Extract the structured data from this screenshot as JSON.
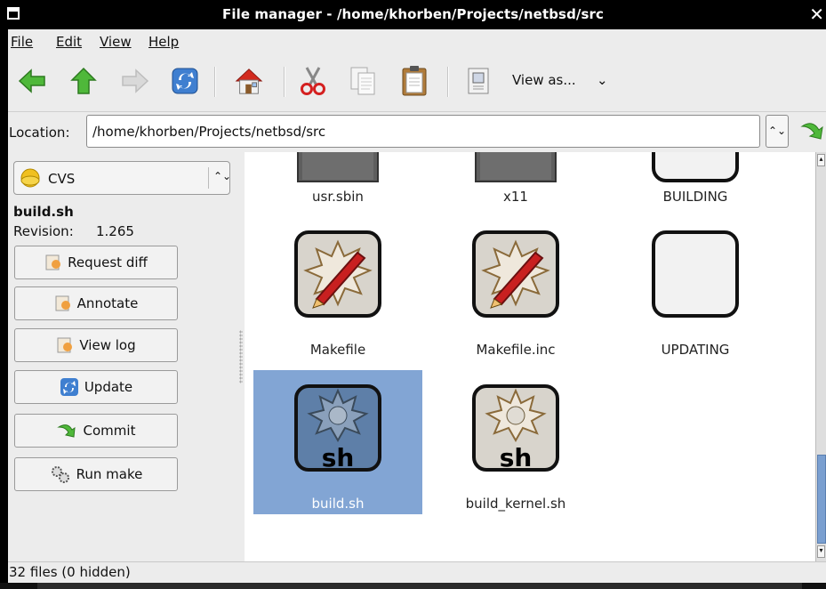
{
  "window": {
    "title": "File manager - /home/khorben/Projects/netbsd/src",
    "close_glyph": "✕"
  },
  "menu": [
    {
      "label": "File"
    },
    {
      "label": "Edit"
    },
    {
      "label": "View"
    },
    {
      "label": "Help"
    }
  ],
  "toolbar": {
    "back_icon": "back-arrow-icon",
    "up_icon": "up-arrow-icon",
    "forward_icon": "forward-arrow-icon",
    "refresh_icon": "refresh-icon",
    "home_icon": "home-icon",
    "cut_icon": "scissors-icon",
    "copy_icon": "copy-icon",
    "paste_icon": "clipboard-icon",
    "properties_icon": "properties-icon",
    "view_as_label": "View as...",
    "view_as_arrow": "⌄"
  },
  "location": {
    "label": "Location:",
    "value": "/home/khorben/Projects/netbsd/src",
    "spin": "⌃⌄"
  },
  "side": {
    "vcs_selected": "CVS",
    "vcs_spin": "⌃⌄",
    "file_name": "build.sh",
    "revision_label": "Revision:",
    "revision_value": "1.265",
    "buttons": [
      {
        "label": "Request diff",
        "icon": "document-hand-icon"
      },
      {
        "label": "Annotate",
        "icon": "document-hand-icon"
      },
      {
        "label": "View log",
        "icon": "document-hand-icon"
      },
      {
        "label": "Update",
        "icon": "refresh-icon"
      },
      {
        "label": "Commit",
        "icon": "green-arrow-icon"
      },
      {
        "label": "Run make",
        "icon": "gears-icon"
      }
    ]
  },
  "files": [
    {
      "name": "usr.sbin",
      "type": "folder"
    },
    {
      "name": "x11",
      "type": "folder"
    },
    {
      "name": "BUILDING",
      "type": "text"
    },
    {
      "name": "Makefile",
      "type": "makefile"
    },
    {
      "name": "Makefile.inc",
      "type": "makefile"
    },
    {
      "name": "UPDATING",
      "type": "text"
    },
    {
      "name": "build.sh",
      "type": "script",
      "selected": true,
      "badge": "sh"
    },
    {
      "name": "build_kernel.sh",
      "type": "script",
      "badge": "sh"
    }
  ],
  "status": {
    "text": "32 files (0 hidden)"
  },
  "colors": {
    "selection": "#82a5d4",
    "window_bg": "#ececec",
    "accent_green": "#3aa12a"
  }
}
